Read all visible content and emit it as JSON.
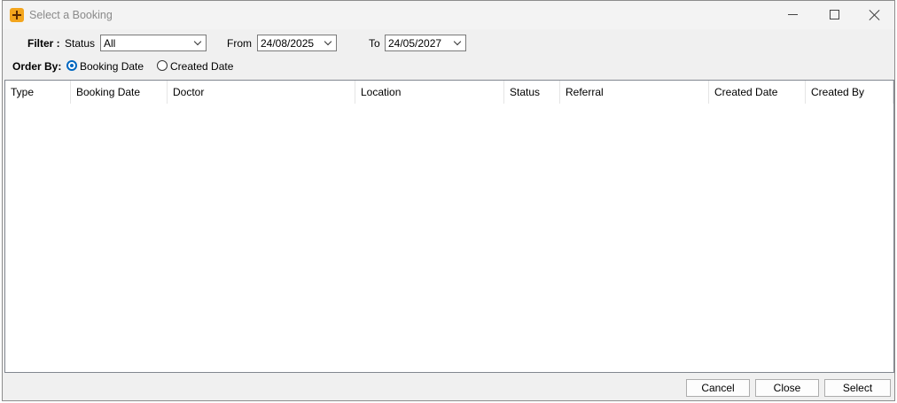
{
  "window": {
    "title": "Select a Booking"
  },
  "filter": {
    "label": "Filter :",
    "status_label": "Status",
    "status_value": "All",
    "from_label": "From",
    "from_value": "24/08/2025",
    "to_label": "To",
    "to_value": "24/05/2027"
  },
  "order_by": {
    "label": "Order By:",
    "options": [
      "Booking Date",
      "Created Date"
    ],
    "selected": "Booking Date"
  },
  "table": {
    "columns": [
      "Type",
      "Booking Date",
      "Doctor",
      "Location",
      "Status",
      "Referral",
      "Created Date",
      "Created By"
    ],
    "rows": []
  },
  "buttons": {
    "cancel": "Cancel",
    "close": "Close",
    "select": "Select"
  },
  "colors": {
    "accent": "#0067c0",
    "icon": "#f3a51d"
  }
}
